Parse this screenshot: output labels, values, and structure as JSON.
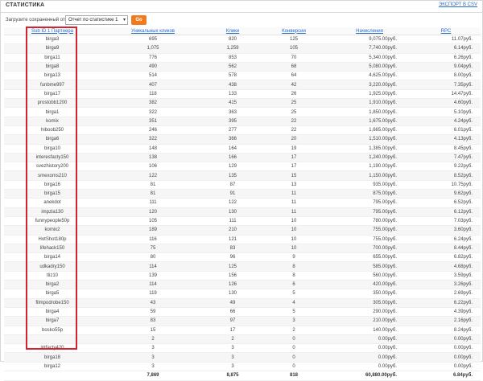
{
  "header": {
    "title": "СТАТИСТИКА",
    "export_label": "ЭКСПОРТ В CSV"
  },
  "toolbar": {
    "load_label": "Загрузите сохраненный отчет",
    "report_value": "Отчет по статистике 1",
    "go_label": "Go"
  },
  "table": {
    "columns": [
      "Sub ID 1 Партнера",
      "Уникальных кликов",
      "Клики",
      "Конверсии",
      "Начисления",
      "RPC"
    ],
    "rows": [
      [
        "birga3",
        "695",
        "820",
        "125",
        "9,075.00руб.",
        "11.07руб."
      ],
      [
        "birga9",
        "1,075",
        "1,259",
        "105",
        "7,740.00руб.",
        "6.14руб."
      ],
      [
        "birga11",
        "776",
        "853",
        "70",
        "5,340.00руб.",
        "6.26руб."
      ],
      [
        "birga8",
        "490",
        "562",
        "68",
        "5,080.00руб.",
        "9.04руб."
      ],
      [
        "birga13",
        "514",
        "578",
        "64",
        "4,625.00руб.",
        "8.00руб."
      ],
      [
        "funbme997",
        "407",
        "438",
        "42",
        "3,220.00руб.",
        "7.35руб."
      ],
      [
        "birga17",
        "118",
        "133",
        "26",
        "1,925.00руб.",
        "14.47руб."
      ],
      [
        "prostobb1200",
        "382",
        "415",
        "25",
        "1,910.00руб.",
        "4.60руб."
      ],
      [
        "birga1",
        "322",
        "363",
        "25",
        "1,850.00руб.",
        "5.10руб."
      ],
      [
        "komix",
        "351",
        "395",
        "22",
        "1,675.00руб.",
        "4.24руб."
      ],
      [
        "hiboob250",
        "246",
        "277",
        "22",
        "1,665.00руб.",
        "6.01руб."
      ],
      [
        "birga6",
        "322",
        "366",
        "20",
        "1,510.00руб.",
        "4.13руб."
      ],
      [
        "birga10",
        "148",
        "164",
        "19",
        "1,385.00руб.",
        "8.45руб."
      ],
      [
        "interesfacty150",
        "138",
        "166",
        "17",
        "1,240.00руб.",
        "7.47руб."
      ],
      [
        "svezhistory200",
        "106",
        "129",
        "17",
        "1,190.00руб.",
        "9.22руб."
      ],
      [
        "smexoms210",
        "122",
        "135",
        "15",
        "1,150.00руб.",
        "8.52руб."
      ],
      [
        "birga16",
        "81",
        "87",
        "13",
        "935.00руб.",
        "10.75руб."
      ],
      [
        "birga15",
        "81",
        "91",
        "11",
        "875.00руб.",
        "9.62руб."
      ],
      [
        "anekdot",
        "111",
        "122",
        "11",
        "795.00руб.",
        "6.52руб."
      ],
      [
        "impzla130",
        "120",
        "130",
        "11",
        "795.00руб.",
        "6.12руб."
      ],
      [
        "funnypeople50p",
        "105",
        "111",
        "10",
        "780.00руб.",
        "7.03руб."
      ],
      [
        "komix2",
        "189",
        "210",
        "10",
        "755.00руб.",
        "3.60руб."
      ],
      [
        "HotShot180p",
        "116",
        "121",
        "10",
        "755.00руб.",
        "6.24руб."
      ],
      [
        "lifehack150",
        "75",
        "83",
        "10",
        "700.00руб.",
        "8.44руб."
      ],
      [
        "birga14",
        "80",
        "96",
        "9",
        "655.00руб.",
        "6.82руб."
      ],
      [
        "udkadry150",
        "114",
        "125",
        "8",
        "585.00руб.",
        "4.68руб."
      ],
      [
        "tliz10",
        "139",
        "156",
        "8",
        "560.00руб.",
        "3.59руб."
      ],
      [
        "birga2",
        "114",
        "126",
        "6",
        "420.00руб.",
        "3.26руб."
      ],
      [
        "birga5",
        "119",
        "130",
        "5",
        "350.00руб.",
        "2.69руб."
      ],
      [
        "filmpodrobe150",
        "43",
        "49",
        "4",
        "305.00руб.",
        "6.22руб."
      ],
      [
        "birga4",
        "59",
        "66",
        "5",
        "290.00руб.",
        "4.39руб."
      ],
      [
        "birga7",
        "83",
        "97",
        "3",
        "210.00руб.",
        "2.16руб."
      ],
      [
        "bosko55p",
        "15",
        "17",
        "2",
        "140.00руб.",
        "8.24руб."
      ],
      [
        "",
        "2",
        "2",
        "0",
        "0.00руб.",
        "0.00руб."
      ],
      [
        "intfacty420",
        "3",
        "3",
        "0",
        "0.00руб.",
        "0.00руб."
      ],
      [
        "birga18",
        "3",
        "3",
        "0",
        "0.00руб.",
        "0.00руб."
      ],
      [
        "birga12",
        "3",
        "3",
        "0",
        "0.00руб.",
        "0.00руб."
      ]
    ],
    "totals": [
      "",
      "7,869",
      "8,875",
      "818",
      "60,880.00руб.",
      "6.84руб."
    ]
  },
  "colors": {
    "accent_link": "#2a6cc4",
    "go_button": "#f07b1d",
    "highlight": "#d4232f"
  }
}
